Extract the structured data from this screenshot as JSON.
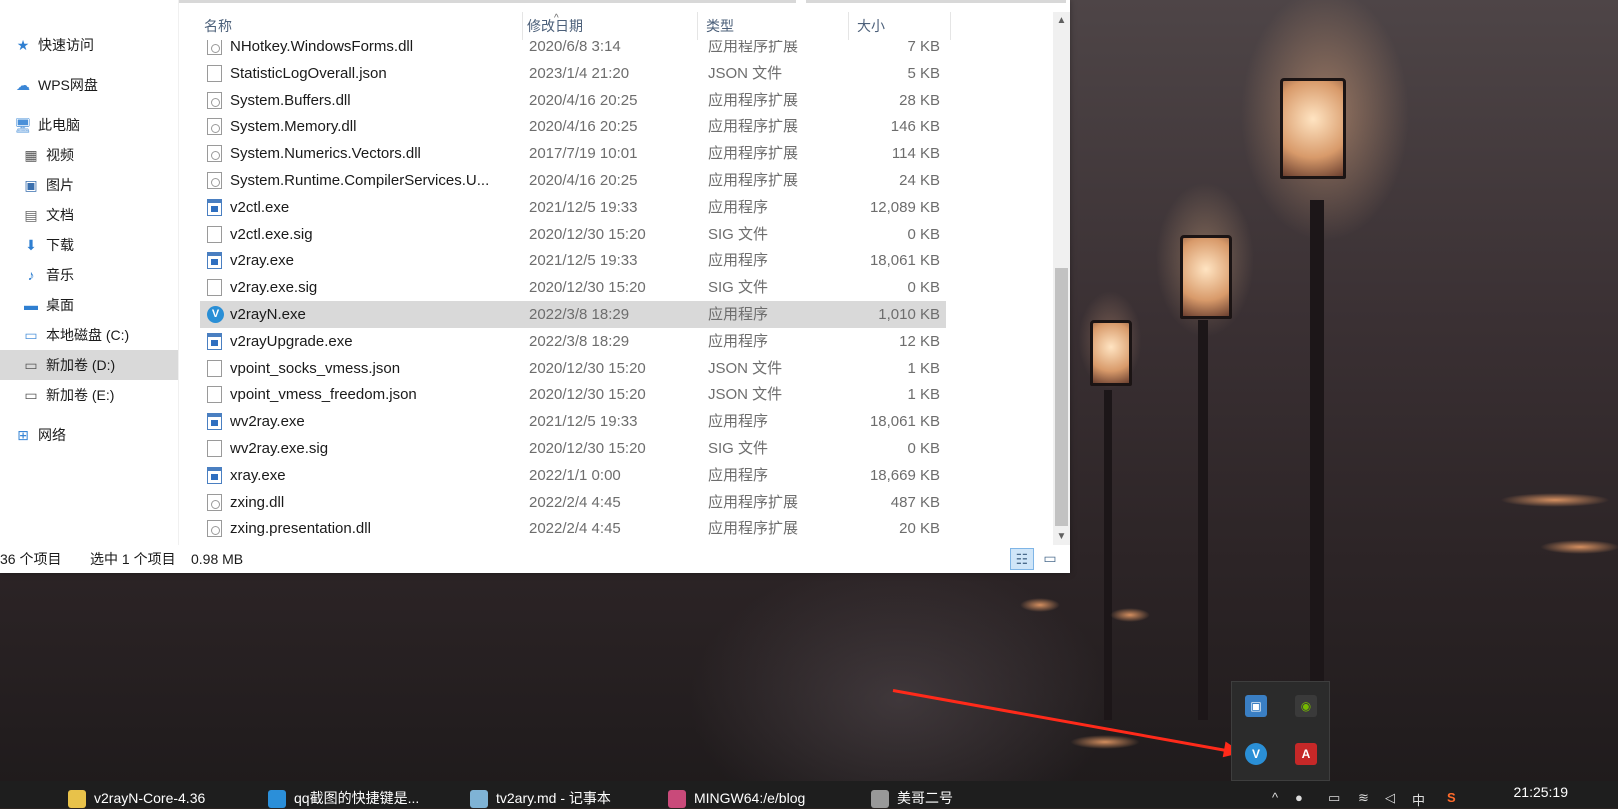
{
  "nav": {
    "items": [
      {
        "label": "快速访问",
        "icon": "star-icon"
      },
      {
        "label": "WPS网盘",
        "icon": "cloud-icon"
      },
      {
        "label": "此电脑",
        "icon": "computer-icon"
      },
      {
        "label": "视频",
        "icon": "video-icon"
      },
      {
        "label": "图片",
        "icon": "picture-icon"
      },
      {
        "label": "文档",
        "icon": "document-icon"
      },
      {
        "label": "下载",
        "icon": "download-icon"
      },
      {
        "label": "音乐",
        "icon": "music-icon"
      },
      {
        "label": "桌面",
        "icon": "desktop-icon"
      },
      {
        "label": "本地磁盘 (C:)",
        "icon": "drive-icon"
      },
      {
        "label": "新加卷 (D:)",
        "icon": "drive-icon",
        "selected": true
      },
      {
        "label": "新加卷 (E:)",
        "icon": "drive-icon"
      },
      {
        "label": "网络",
        "icon": "network-icon"
      }
    ]
  },
  "columns": {
    "name": "名称",
    "date": "修改日期",
    "type": "类型",
    "size": "大小"
  },
  "files": [
    {
      "name": "NHotkey.WindowsForms.dll",
      "date": "2020/6/8 3:14",
      "type": "应用程序扩展",
      "size": "7 KB",
      "icon": "dll"
    },
    {
      "name": "StatisticLogOverall.json",
      "date": "2023/1/4 21:20",
      "type": "JSON 文件",
      "size": "5 KB",
      "icon": "doc"
    },
    {
      "name": "System.Buffers.dll",
      "date": "2020/4/16 20:25",
      "type": "应用程序扩展",
      "size": "28 KB",
      "icon": "dll"
    },
    {
      "name": "System.Memory.dll",
      "date": "2020/4/16 20:25",
      "type": "应用程序扩展",
      "size": "146 KB",
      "icon": "dll"
    },
    {
      "name": "System.Numerics.Vectors.dll",
      "date": "2017/7/19 10:01",
      "type": "应用程序扩展",
      "size": "114 KB",
      "icon": "dll"
    },
    {
      "name": "System.Runtime.CompilerServices.U...",
      "date": "2020/4/16 20:25",
      "type": "应用程序扩展",
      "size": "24 KB",
      "icon": "dll"
    },
    {
      "name": "v2ctl.exe",
      "date": "2021/12/5 19:33",
      "type": "应用程序",
      "size": "12,089 KB",
      "icon": "exe"
    },
    {
      "name": "v2ctl.exe.sig",
      "date": "2020/12/30 15:20",
      "type": "SIG 文件",
      "size": "0 KB",
      "icon": "doc"
    },
    {
      "name": "v2ray.exe",
      "date": "2021/12/5 19:33",
      "type": "应用程序",
      "size": "18,061 KB",
      "icon": "exe"
    },
    {
      "name": "v2ray.exe.sig",
      "date": "2020/12/30 15:20",
      "type": "SIG 文件",
      "size": "0 KB",
      "icon": "doc"
    },
    {
      "name": "v2rayN.exe",
      "date": "2022/3/8 18:29",
      "type": "应用程序",
      "size": "1,010 KB",
      "icon": "v2n",
      "selected": true
    },
    {
      "name": "v2rayUpgrade.exe",
      "date": "2022/3/8 18:29",
      "type": "应用程序",
      "size": "12 KB",
      "icon": "exe"
    },
    {
      "name": "vpoint_socks_vmess.json",
      "date": "2020/12/30 15:20",
      "type": "JSON 文件",
      "size": "1 KB",
      "icon": "doc"
    },
    {
      "name": "vpoint_vmess_freedom.json",
      "date": "2020/12/30 15:20",
      "type": "JSON 文件",
      "size": "1 KB",
      "icon": "doc"
    },
    {
      "name": "wv2ray.exe",
      "date": "2021/12/5 19:33",
      "type": "应用程序",
      "size": "18,061 KB",
      "icon": "exe"
    },
    {
      "name": "wv2ray.exe.sig",
      "date": "2020/12/30 15:20",
      "type": "SIG 文件",
      "size": "0 KB",
      "icon": "doc"
    },
    {
      "name": "xray.exe",
      "date": "2022/1/1 0:00",
      "type": "应用程序",
      "size": "18,669 KB",
      "icon": "exe"
    },
    {
      "name": "zxing.dll",
      "date": "2022/2/4 4:45",
      "type": "应用程序扩展",
      "size": "487 KB",
      "icon": "dll"
    },
    {
      "name": "zxing.presentation.dll",
      "date": "2022/2/4 4:45",
      "type": "应用程序扩展",
      "size": "20 KB",
      "icon": "dll"
    }
  ],
  "status": {
    "count": "36 个项目",
    "selected": "选中 1 个项目",
    "size": "0.98 MB"
  },
  "taskbar": {
    "tasks": [
      {
        "label": "v2rayN-Core-4.36",
        "color": "#e8c24a"
      },
      {
        "label": "qq截图的快捷键是...",
        "color": "#2b8fd9"
      },
      {
        "label": "tv2ary.md - 记事本",
        "color": "#7fb3d5"
      },
      {
        "label": "MINGW64:/e/blog",
        "color": "#c94a7a"
      },
      {
        "label": "美哥二号",
        "color": "#999999"
      }
    ],
    "clock": "21:25:19",
    "ime": "中"
  }
}
